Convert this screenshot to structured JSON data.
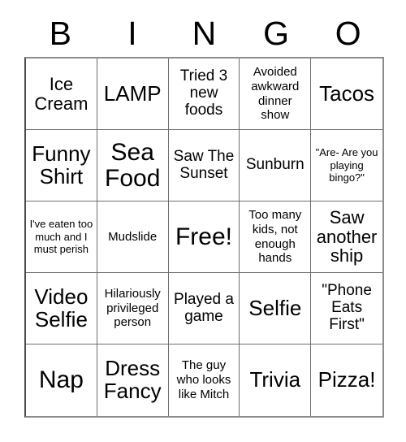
{
  "card": {
    "title_letters": [
      "B",
      "I",
      "N",
      "G",
      "O"
    ],
    "columns": 5,
    "rows": 5,
    "free_space_label": "Free!",
    "free_space_position": {
      "row": 3,
      "column": 3
    },
    "colors": {
      "background": "#ffffff",
      "text": "#000000",
      "cell_border": "#6e6e6e",
      "outer_border": "#8c8c8c"
    },
    "rows_data": [
      [
        {
          "text": "Ice Cream",
          "size": "lg"
        },
        {
          "text": "LAMP",
          "size": "xl"
        },
        {
          "text": "Tried 3 new foods",
          "size": "md"
        },
        {
          "text": "Avoided awkward dinner show",
          "size": "sm"
        },
        {
          "text": "Tacos",
          "size": "xl"
        }
      ],
      [
        {
          "text": "Funny Shirt",
          "size": "xl"
        },
        {
          "text": "Sea Food",
          "size": "xxl"
        },
        {
          "text": "Saw The Sunset",
          "size": "md"
        },
        {
          "text": "Sunburn",
          "size": "md"
        },
        {
          "text": "\"Are- Are you playing bingo?\"",
          "size": "xs"
        }
      ],
      [
        {
          "text": "I've eaten too much and I must perish",
          "size": "xs"
        },
        {
          "text": "Mudslide",
          "size": "sm"
        },
        {
          "text": "Free!",
          "size": "xxl"
        },
        {
          "text": "Too many kids, not enough hands",
          "size": "sm"
        },
        {
          "text": "Saw another ship",
          "size": "lg"
        }
      ],
      [
        {
          "text": "Video Selfie",
          "size": "xl"
        },
        {
          "text": "Hilariously privileged person",
          "size": "sm"
        },
        {
          "text": "Played a game",
          "size": "md"
        },
        {
          "text": "Selfie",
          "size": "xl"
        },
        {
          "text": "\"Phone Eats First\"",
          "size": "md"
        }
      ],
      [
        {
          "text": "Nap",
          "size": "xxl"
        },
        {
          "text": "Dress Fancy",
          "size": "xl"
        },
        {
          "text": "The guy who looks like Mitch",
          "size": "sm"
        },
        {
          "text": "Trivia",
          "size": "xl"
        },
        {
          "text": "Pizza!",
          "size": "xl"
        }
      ]
    ]
  }
}
